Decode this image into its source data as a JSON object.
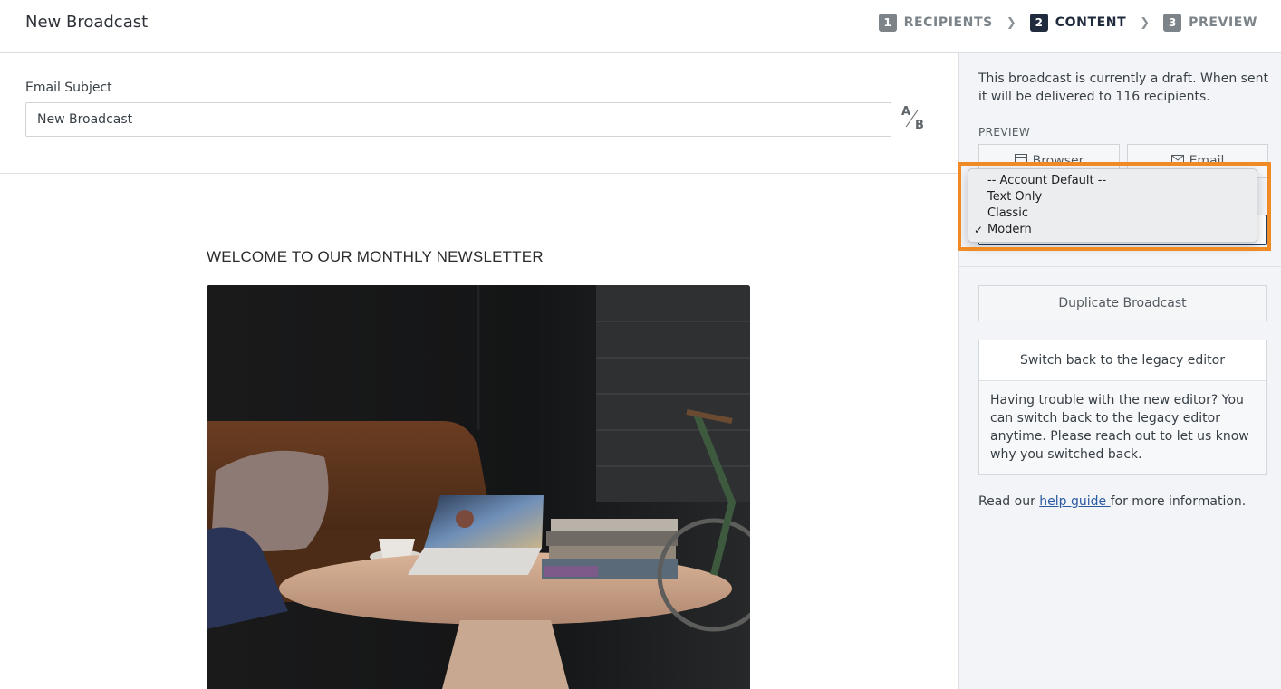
{
  "header": {
    "title": "New Broadcast",
    "steps": [
      {
        "number": "1",
        "label": "RECIPIENTS",
        "active": false
      },
      {
        "number": "2",
        "label": "CONTENT",
        "active": true
      },
      {
        "number": "3",
        "label": "PREVIEW",
        "active": false
      }
    ]
  },
  "subject": {
    "label": "Email Subject",
    "value": "New Broadcast",
    "ab_a": "A",
    "ab_b": "B"
  },
  "newsletter": {
    "heading": "WELCOME TO OUR MONTHLY NEWSLETTER",
    "image": "living-room-laptop-photo"
  },
  "sidebar": {
    "draft_text": "This broadcast is currently a draft. When sent it will be delivered to 116 recipients.",
    "preview_label": "PREVIEW",
    "preview_browser": "Browser",
    "preview_email": "Email",
    "duplicate_label": "Duplicate Broadcast",
    "legacy_button": "Switch back to the legacy editor",
    "legacy_text": "Having trouble with the new editor? You can switch back to the legacy editor anytime. Please reach out to let us know why you switched back.",
    "guide_prefix": "Read our ",
    "guide_link": "help guide ",
    "guide_suffix": "for more information."
  },
  "style_dropdown": {
    "options": [
      "-- Account Default --",
      "Text Only",
      "Classic",
      "Modern"
    ],
    "selected": "Modern",
    "check": "✓"
  },
  "colors": {
    "highlight": "#f08a24",
    "active_step": "#1f2a3c",
    "inactive_step": "#7c848a",
    "sidebar_bg": "#f2f4f8",
    "link": "#2c5aa0"
  }
}
